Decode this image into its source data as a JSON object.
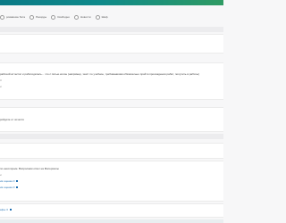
{
  "filters": [
    {
      "label": "ровавшие бота",
      "checked": false
    },
    {
      "label": "Рекорды",
      "checked": false
    },
    {
      "label": "Свободно",
      "checked": false
    },
    {
      "label": "Новости",
      "checked": false
    },
    {
      "label": "Шаф",
      "checked": false
    }
  ],
  "sections": [
    {
      "lines": [
        "рабочий аттестат и работодатель... что с пятью колон (например, текст по учебное, требованиями обязательно пройти прохождения работ, получить в работы)",
        "3",
        "и"
      ]
    },
    {
      "lines": [
        "ройдите от хочется"
      ]
    },
    {
      "lines": [
        "по некоторым. Вопросами ответ на Материалы",
        "и",
        "ия оценка 3",
        "ия оценка 3"
      ]
    },
    {
      "lines": [
        "ефы 3"
      ]
    }
  ]
}
